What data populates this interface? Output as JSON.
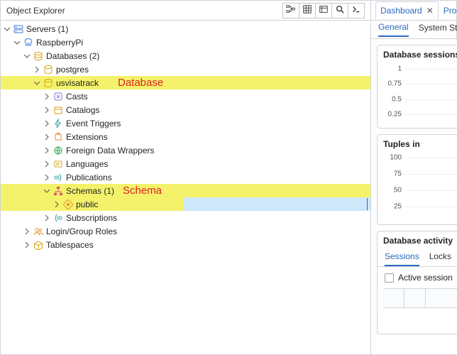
{
  "left": {
    "title": "Object Explorer",
    "toolbar": [
      "structure",
      "grid",
      "filter",
      "search",
      "terminal"
    ]
  },
  "tree": {
    "servers": {
      "label": "Servers (1)"
    },
    "raspberry": {
      "label": "RaspberryPi"
    },
    "databases": {
      "label": "Databases (2)"
    },
    "postgres": {
      "label": "postgres"
    },
    "usvisatrack": {
      "label": "usvisatrack"
    },
    "casts": {
      "label": "Casts"
    },
    "catalogs": {
      "label": "Catalogs"
    },
    "event_triggers": {
      "label": "Event Triggers"
    },
    "extensions": {
      "label": "Extensions"
    },
    "fdw": {
      "label": "Foreign Data Wrappers"
    },
    "languages": {
      "label": "Languages"
    },
    "publications": {
      "label": "Publications"
    },
    "schemas": {
      "label": "Schemas (1)"
    },
    "public": {
      "label": "public"
    },
    "subscriptions": {
      "label": "Subscriptions"
    },
    "login_roles": {
      "label": "Login/Group Roles"
    },
    "tablespaces": {
      "label": "Tablespaces"
    }
  },
  "annotations": {
    "database": "Database",
    "schema": "Schema"
  },
  "right": {
    "tabs": {
      "dashboard": "Dashboard",
      "properties": "Proper"
    },
    "subtabs": {
      "general": "General",
      "system": "System St"
    },
    "section_sessions": "Database sessions",
    "section_tuples": "Tuples in",
    "section_activity": "Database activity",
    "activity_tabs": {
      "sessions": "Sessions",
      "locks": "Locks"
    },
    "active_sessions": "Active session"
  },
  "chart_data": [
    {
      "type": "line",
      "title": "Database sessions",
      "yticks": [
        0.25,
        0.5,
        0.75,
        1
      ],
      "ylim": [
        0,
        1
      ],
      "series": []
    },
    {
      "type": "line",
      "title": "Tuples in",
      "yticks": [
        25,
        50,
        75,
        100
      ],
      "ylim": [
        0,
        100
      ],
      "series": []
    }
  ],
  "colors": {
    "link": "#2a6ac1",
    "highlight": "#f4f26a",
    "selection": "#cfe8fb",
    "annotation": "#d92424",
    "gold": "#d9a514",
    "green": "#3aa657",
    "blue": "#3b7dd8",
    "orange": "#e88b2e",
    "teal": "#2aa0a0"
  }
}
